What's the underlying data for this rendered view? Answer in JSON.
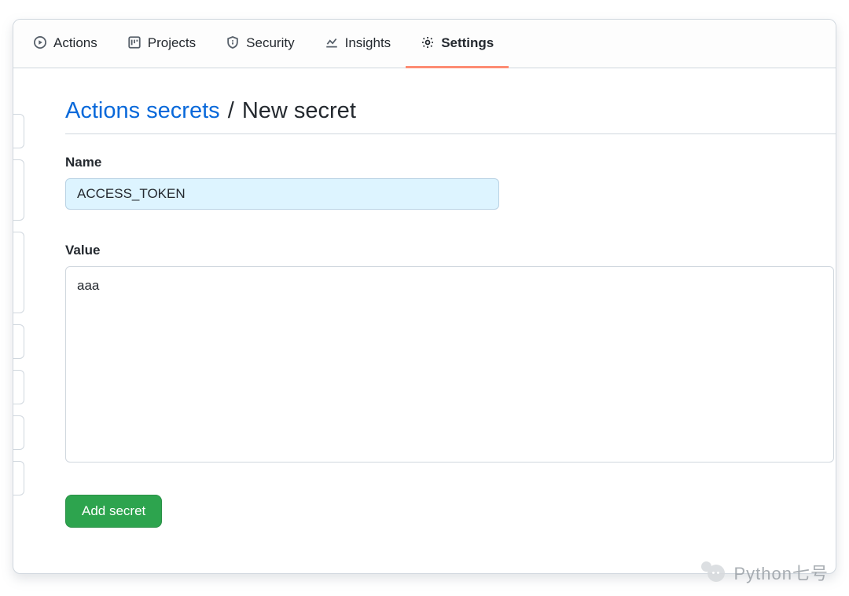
{
  "tabs": {
    "actions": {
      "label": "Actions"
    },
    "projects": {
      "label": "Projects"
    },
    "security": {
      "label": "Security"
    },
    "insights": {
      "label": "Insights"
    },
    "settings": {
      "label": "Settings"
    }
  },
  "breadcrumb": {
    "parent": "Actions secrets",
    "separator": "/",
    "current": "New secret"
  },
  "form": {
    "name_label": "Name",
    "name_value": "ACCESS_TOKEN",
    "value_label": "Value",
    "value_text": "aaa",
    "submit_label": "Add secret"
  },
  "watermark": {
    "text": "Python七号"
  }
}
